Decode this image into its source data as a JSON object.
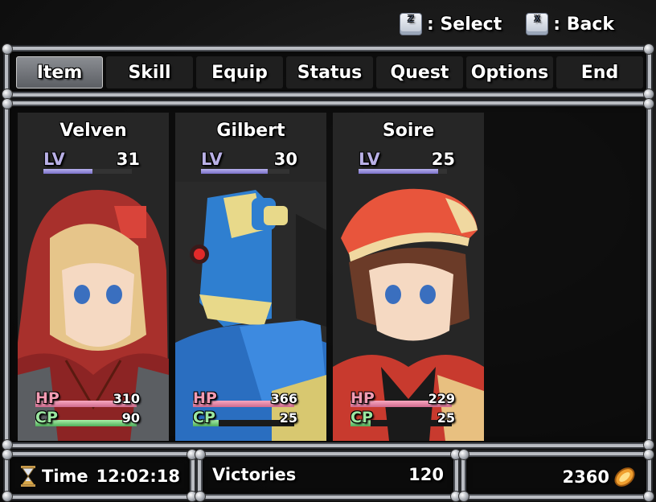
{
  "hints": [
    {
      "key": "Z",
      "label": ": Select"
    },
    {
      "key": "X",
      "label": ": Back"
    }
  ],
  "menu": {
    "items": [
      "Item",
      "Skill",
      "Equip",
      "Status",
      "Quest",
      "Options",
      "End"
    ],
    "active": "Item"
  },
  "party": [
    {
      "name": "Velven",
      "lv_label": "LV",
      "lv": "31",
      "lv_progress": 0.55,
      "hp_label": "HP",
      "hp": "310",
      "hp_fill": 1.0,
      "cp_label": "CP",
      "cp": "90",
      "cp_fill": 1.0
    },
    {
      "name": "Gilbert",
      "lv_label": "LV",
      "lv": "30",
      "lv_progress": 0.75,
      "hp_label": "HP",
      "hp": "366",
      "hp_fill": 1.0,
      "cp_label": "CP",
      "cp": "25",
      "cp_fill": 0.25
    },
    {
      "name": "Soire",
      "lv_label": "LV",
      "lv": "25",
      "lv_progress": 0.9,
      "hp_label": "HP",
      "hp": "229",
      "hp_fill": 1.0,
      "cp_label": "CP",
      "cp": "25",
      "cp_fill": 0.2
    }
  ],
  "footer": {
    "time_label": "Time",
    "time": "12:02:18",
    "victories_label": "Victories",
    "victories": "120",
    "gold": "2360"
  },
  "colors": {
    "hp": "#e07a9c",
    "cp": "#6fcf74",
    "lv": "#8f86d8",
    "frame": "#b9bcc2"
  }
}
